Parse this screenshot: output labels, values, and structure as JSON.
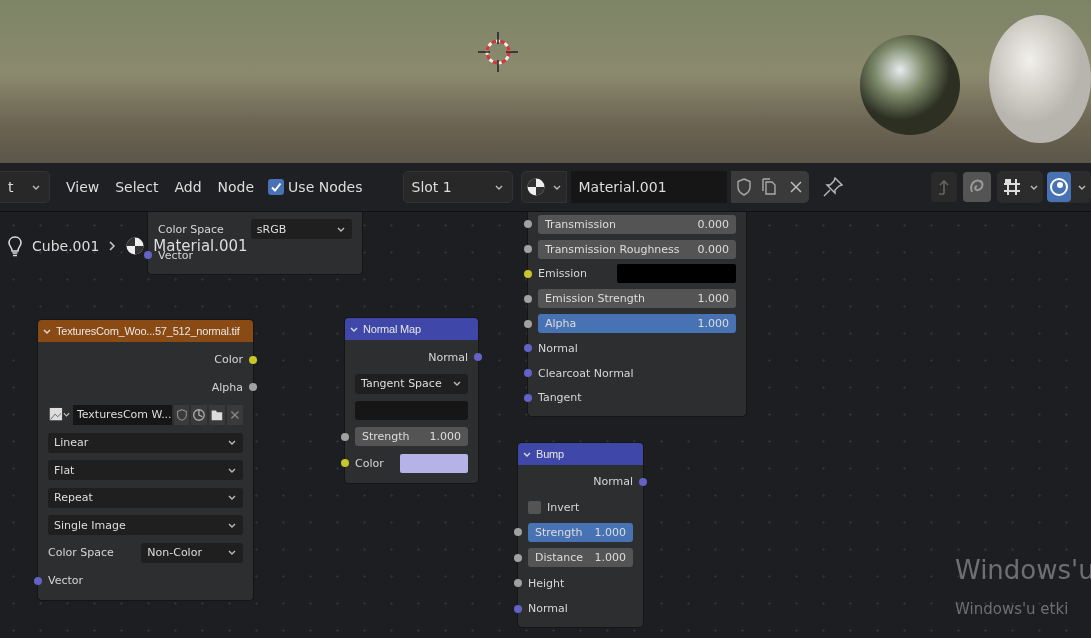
{
  "header": {
    "editor_type": "t",
    "menus": [
      "View",
      "Select",
      "Add",
      "Node"
    ],
    "use_nodes": {
      "label": "Use Nodes",
      "checked": true
    },
    "slot": "Slot 1",
    "material": "Material.001"
  },
  "breadcrumb": {
    "object": "Cube.001",
    "material": "Material.001"
  },
  "nodes": [
    {
      "kind": "partial",
      "rows": [
        {
          "kind": "dropdown",
          "label": "Color Space",
          "value": "sRGB"
        },
        {
          "kind": "input",
          "label": "Vector",
          "color": "#6363c7"
        }
      ]
    },
    {
      "kind": "partial",
      "rows": [
        {
          "kind": "slider",
          "label": "Transmission",
          "value": "0.000",
          "selected": false,
          "color": "#a1a1a1"
        },
        {
          "kind": "slider",
          "label": "Transmission Roughness",
          "value": "0.000",
          "selected": false,
          "color": "#a1a1a1"
        },
        {
          "kind": "color_input",
          "label": "Emission",
          "swatch": {
            "color": "#000000"
          },
          "color": "#c7c729"
        },
        {
          "kind": "slider",
          "label": "Emission Strength",
          "value": "1.000",
          "selected": false,
          "color": "#a1a1a1"
        },
        {
          "kind": "slider",
          "label": "Alpha",
          "value": "1.000",
          "selected": true,
          "color": "#a1a1a1"
        },
        {
          "kind": "input",
          "label": "Normal",
          "color": "#6363c7"
        },
        {
          "kind": "input",
          "label": "Clearcoat Normal",
          "color": "#6363c7"
        },
        {
          "kind": "input",
          "label": "Tangent",
          "color": "#6363c7"
        }
      ]
    },
    {
      "kind": "texture",
      "title": "TexturesCom_Woo...57_512_normal.tif",
      "rows": [
        {
          "kind": "output",
          "label": "Color",
          "color": "#c7c729"
        },
        {
          "kind": "output",
          "label": "Alpha",
          "color": "#a1a1a1"
        },
        {
          "kind": "image",
          "value": "TexturesCom W..."
        },
        {
          "kind": "dropdown",
          "value": "Linear"
        },
        {
          "kind": "dropdown",
          "value": "Flat"
        },
        {
          "kind": "dropdown",
          "value": "Repeat"
        },
        {
          "kind": "dropdown",
          "value": "Single Image"
        },
        {
          "kind": "dropdown",
          "label": "Color Space",
          "value": "Non-Color"
        },
        {
          "kind": "input",
          "label": "Vector",
          "color": "#6363c7"
        }
      ]
    },
    {
      "kind": "vector",
      "title": "Normal Map",
      "rows": [
        {
          "kind": "output",
          "label": "Normal",
          "color": "#6363c7"
        },
        {
          "kind": "dropdown",
          "value": "Tangent Space"
        },
        {
          "kind": "field"
        },
        {
          "kind": "slider",
          "label": "Strength",
          "value": "1.000",
          "selected": false,
          "color": "#a1a1a1"
        },
        {
          "kind": "color_input",
          "label": "Color",
          "swatch": {
            "color": "#b4b2e6"
          },
          "color": "#c7c729"
        }
      ]
    },
    {
      "kind": "vector",
      "title": "Bump",
      "rows": [
        {
          "kind": "output",
          "label": "Normal",
          "color": "#6363c7"
        },
        {
          "kind": "checkbox",
          "label": "Invert",
          "checked": false
        },
        {
          "kind": "slider",
          "label": "Strength",
          "value": "1.000",
          "selected": true,
          "color": "#a1a1a1"
        },
        {
          "kind": "slider",
          "label": "Distance",
          "value": "1.000",
          "selected": false,
          "color": "#a1a1a1"
        },
        {
          "kind": "input",
          "label": "Height",
          "color": "#a1a1a1"
        },
        {
          "kind": "input",
          "label": "Normal",
          "color": "#6363c7"
        }
      ]
    }
  ],
  "system_notice": {
    "title": "Windows'u",
    "subtitle": "Windows'u etki"
  }
}
